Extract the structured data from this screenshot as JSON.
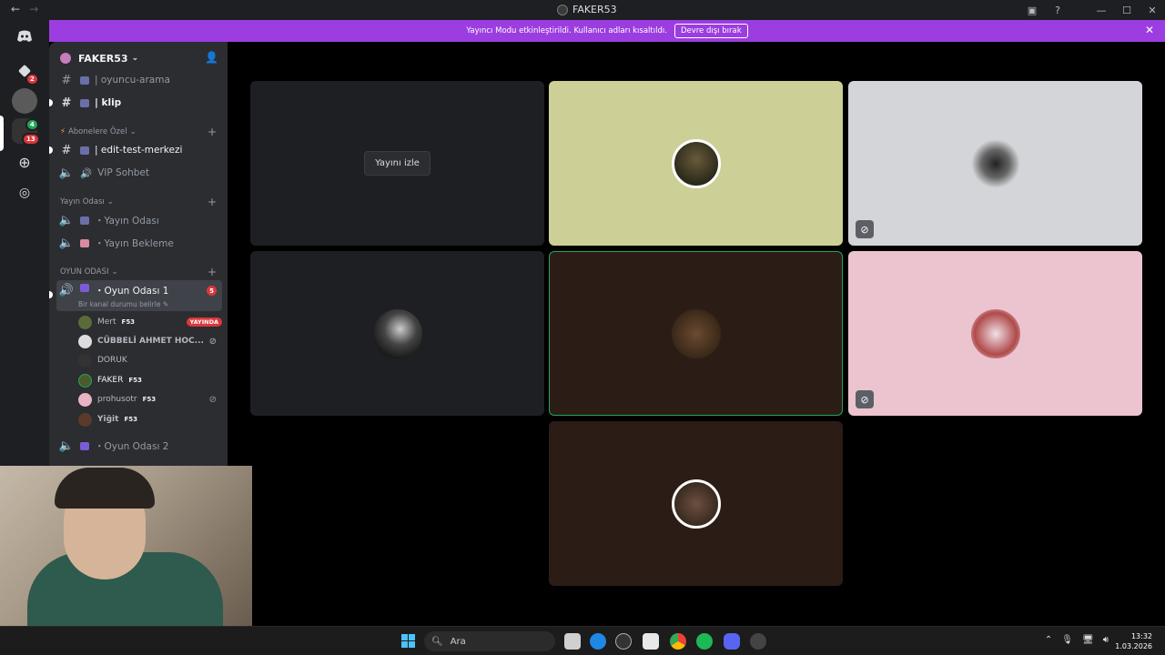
{
  "window": {
    "title": "FAKER53"
  },
  "banner": {
    "message": "Yayıncı Modu etkinleştirildi. Kullanıcı adları kısaltıldı.",
    "button": "Devre dışı bırak"
  },
  "rail": {
    "badges": [
      "2",
      "4",
      "13"
    ]
  },
  "guild": {
    "name": "FAKER53"
  },
  "channels": {
    "oyuncu_arama": "| oyuncu-arama",
    "klip": "| klip",
    "cat_abone": "Abonelere Özel",
    "edit": "| edit-test-merkezi",
    "vip": "VIP Sohbet",
    "cat_yayin": "Yayın Odası",
    "yayin_odasi": "・Yayın Odası",
    "yayin_bekleme": "・Yayın Bekleme",
    "cat_oyun": "OYUN ODASI",
    "oyun1": "・Oyun Odası 1",
    "oyun1_count": "5",
    "oyun1_status": "Bir kanal durumu belirle",
    "oyun2": "・Oyun Odası 2"
  },
  "voice_users": [
    {
      "name": "Mert",
      "tag": "F53",
      "live": "YAYINDA"
    },
    {
      "name": "CÜBBELİ AHMET HOC...",
      "tag": ""
    },
    {
      "name": "DORUK",
      "tag": ""
    },
    {
      "name": "FAKER",
      "tag": "F53"
    },
    {
      "name": "prohusotr",
      "tag": "F53"
    },
    {
      "name": "Yiğit",
      "tag": "F53"
    }
  ],
  "stage": {
    "watch_label": "Yayını izle"
  },
  "taskbar": {
    "search_placeholder": "Ara",
    "time": "13:32",
    "date": "1.03.2026"
  },
  "colors": {
    "banner": "#9b3de0",
    "tile_green": "#ccd096",
    "tile_grey": "#d4d5d8",
    "tile_pink": "#ebc4cf",
    "tile_brown": "#2b1d16",
    "speaking": "#23a55a"
  }
}
